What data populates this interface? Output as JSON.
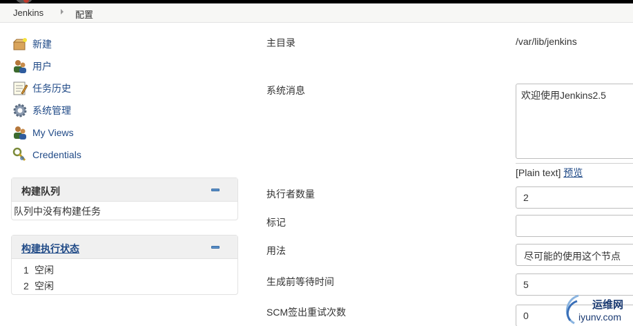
{
  "breadcrumb": {
    "root": "Jenkins",
    "current": "配置"
  },
  "tasks": [
    {
      "label": "新建",
      "icon": "new-item-icon"
    },
    {
      "label": "用户",
      "icon": "people-icon"
    },
    {
      "label": "任务历史",
      "icon": "notepad-icon"
    },
    {
      "label": "系统管理",
      "icon": "gear-icon"
    },
    {
      "label": "My Views",
      "icon": "people-icon"
    },
    {
      "label": "Credentials",
      "icon": "key-icon"
    }
  ],
  "build_queue": {
    "title": "构建队列",
    "empty_text": "队列中没有构建任务"
  },
  "executors": {
    "title": "构建执行状态",
    "rows": [
      {
        "num": "1",
        "status": "空闲"
      },
      {
        "num": "2",
        "status": "空闲"
      }
    ]
  },
  "form": {
    "home_dir_label": "主目录",
    "home_dir_value": "/var/lib/jenkins",
    "system_message_label": "系统消息",
    "system_message_value": "欢迎使用Jenkins2.5",
    "plain_text": "[Plain text]",
    "preview": "预览",
    "executors_label": "执行者数量",
    "executors_value": "2",
    "labels_label": "标记",
    "labels_value": "",
    "usage_label": "用法",
    "usage_value": "尽可能的使用这个节点",
    "quiet_period_label": "生成前等待时间",
    "quiet_period_value": "5",
    "scm_retry_label": "SCM签出重试次数",
    "scm_retry_value": "0"
  },
  "watermark": {
    "cn": "运维网",
    "en": "iyunv.com"
  },
  "colors": {
    "link": "#204a87",
    "panel_header": "#f0f0f0",
    "breadcrumb_bg": "#f7f7f5"
  }
}
